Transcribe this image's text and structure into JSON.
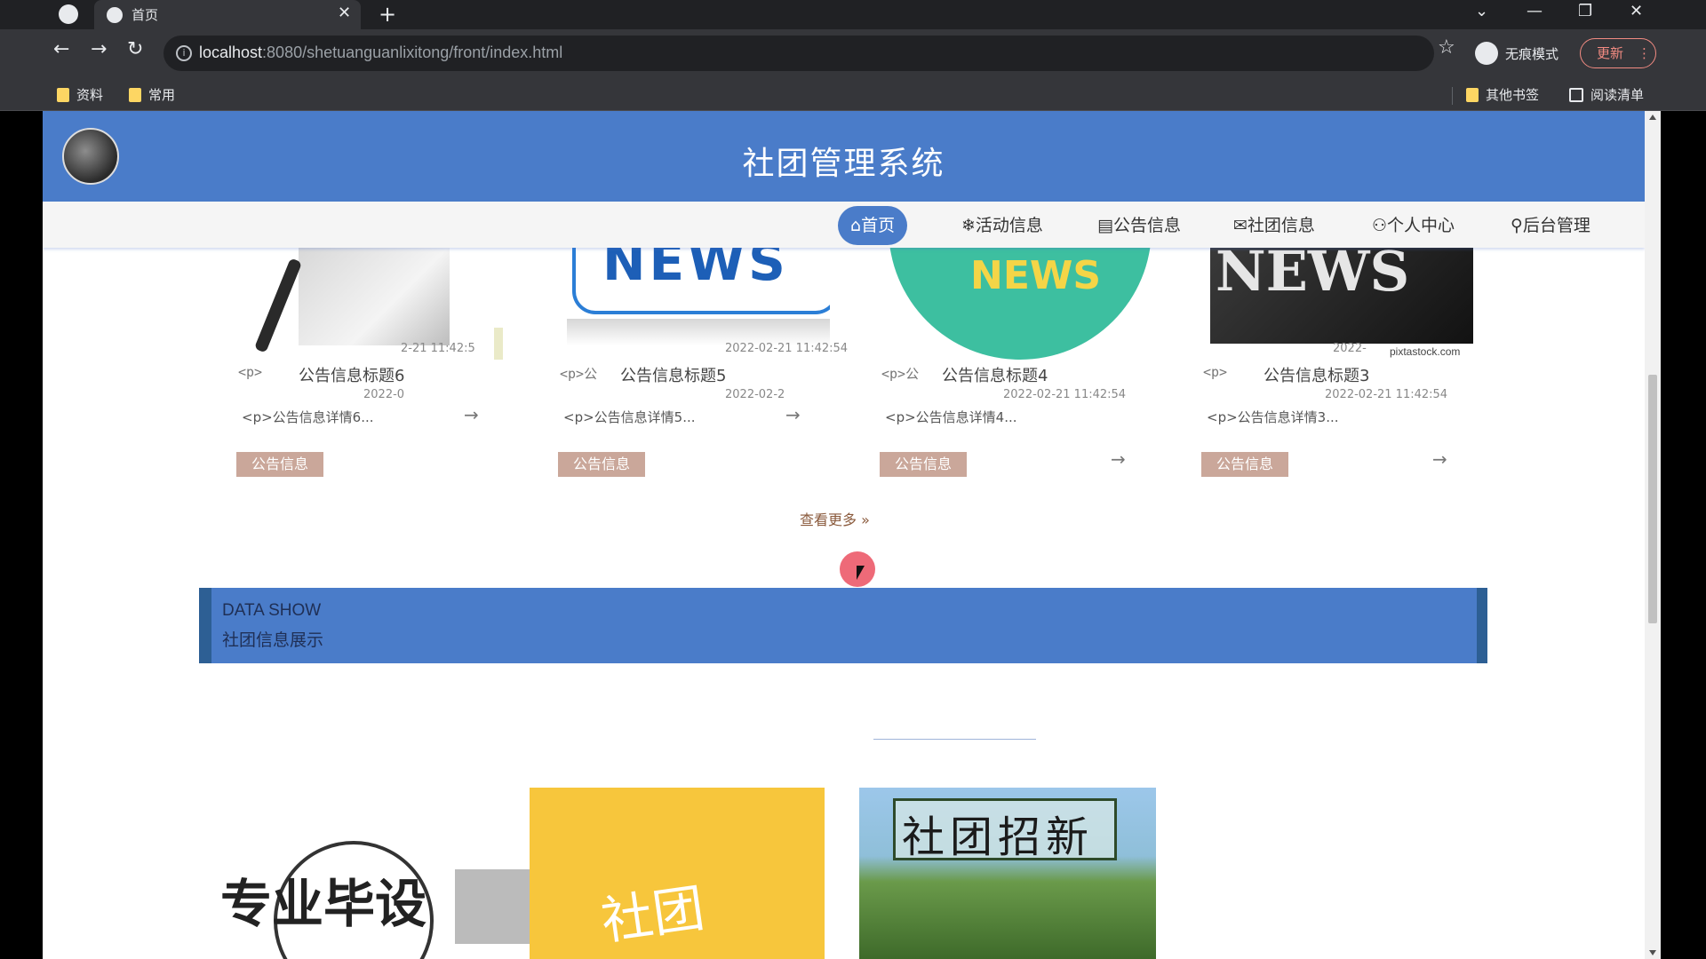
{
  "browser": {
    "tab_title": "首页",
    "tab_close": "✕",
    "new_tab": "+",
    "url_host": "localhost",
    "url_rest": ":8080/shetuanguanlixitong/front/index.html",
    "incognito_label": "无痕模式",
    "update_label": "更新",
    "bookmarks": [
      "资料",
      "常用"
    ],
    "other_bookmarks": "其他书签",
    "reading_list": "阅读清单"
  },
  "site": {
    "title": "社团管理系统",
    "menu": [
      {
        "icon": "⌂",
        "label": "首页"
      },
      {
        "icon": "❄",
        "label": "活动信息"
      },
      {
        "icon": "▤",
        "label": "公告信息"
      },
      {
        "icon": "✉",
        "label": "社团信息"
      },
      {
        "icon": "⚇",
        "label": "个人中心"
      },
      {
        "icon": "⚲",
        "label": "后台管理"
      }
    ]
  },
  "cards": [
    {
      "date_top": "2-21 11:42:5",
      "p": "<p>",
      "title": "公告信息标题6",
      "date2": "2022-0",
      "detail": "<p>公告信息详情6...",
      "arrow": "→",
      "tag": "公告信息"
    },
    {
      "date_top": "2022-02-21 11:42:54",
      "p": "<p>公",
      "title": "公告信息标题5",
      "date2": "2022-02-2",
      "detail": "<p>公告信息详情5...",
      "arrow": "→",
      "tag": "公告信息"
    },
    {
      "date_top": "",
      "p": "<p>公",
      "title": "公告信息标题4",
      "date2": "2022-02-21 11:42:54",
      "detail": "<p>公告信息详情4...",
      "arrow": "→",
      "tag": "公告信息"
    },
    {
      "date_top": "2022-",
      "p": "<p>",
      "title": "公告信息标题3",
      "date2": "2022-02-21 11:42:54",
      "detail": "<p>公告信息详情3...",
      "arrow": "→",
      "tag": "公告信息"
    }
  ],
  "image_texts": {
    "news1": "NEWS",
    "news2": "NEWS",
    "news3": "NEWS",
    "watermark": "pixtastock.com",
    "club1": "专业毕设",
    "club2": "社团",
    "club3": "社团招新"
  },
  "more": {
    "label": "查看更多",
    "chevron": "»"
  },
  "banner": {
    "en": "DATA SHOW",
    "cn": "社团信息展示"
  }
}
